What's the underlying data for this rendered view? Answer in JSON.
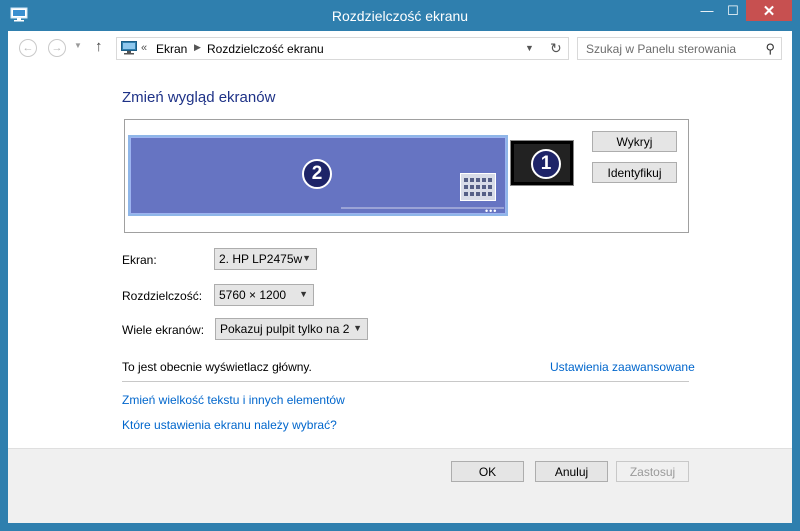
{
  "window": {
    "title": "Rozdzielczość ekranu",
    "controls": {
      "minimize": "—",
      "maximize": "☐",
      "close": "✕"
    }
  },
  "address_bar": {
    "overflow": "«",
    "breadcrumbs": [
      "Ekran",
      "Rozdzielczość ekranu"
    ],
    "search_placeholder": "Szukaj w Panelu sterowania"
  },
  "main": {
    "heading": "Zmień wygląd ekranów",
    "monitors": [
      {
        "number": "2",
        "selected": true
      },
      {
        "number": "1",
        "selected": false
      }
    ],
    "detect_button": "Wykryj",
    "identify_button": "Identyfikuj",
    "fields": {
      "screen": {
        "label": "Ekran:",
        "value": "2. HP LP2475w"
      },
      "resolution": {
        "label": "Rozdzielczość:",
        "value": "5760 × 1200"
      },
      "multiple": {
        "label": "Wiele ekranów:",
        "value": "Pokazuj pulpit tylko na 2"
      }
    },
    "primary_text": "To jest obecnie wyświetlacz główny.",
    "advanced_link": "Ustawienia zaawansowane",
    "links": [
      "Zmień wielkość tekstu i innych elementów",
      "Które ustawienia ekranu należy wybrać?"
    ]
  },
  "footer": {
    "ok": "OK",
    "cancel": "Anuluj",
    "apply": "Zastosuj"
  },
  "colors": {
    "title_bar": "#2f7fae",
    "heading": "#1e3287",
    "link": "#0066cc",
    "monitor_selected": "#6674c2"
  }
}
